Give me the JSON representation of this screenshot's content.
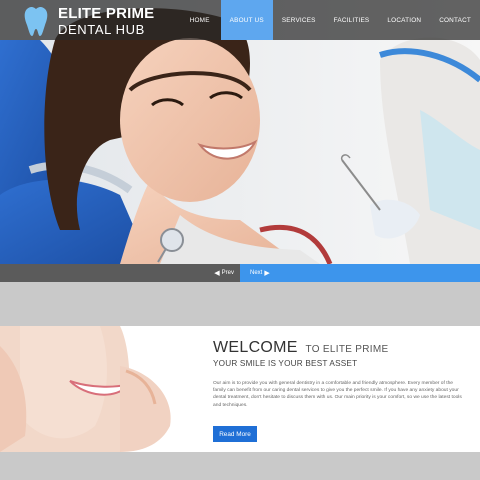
{
  "brand": {
    "line1": "ELITE PRIME",
    "line2": "DENTAL HUB"
  },
  "nav": {
    "items": [
      {
        "label": "HOME",
        "active": false
      },
      {
        "label": "ABOUT US",
        "active": true
      },
      {
        "label": "SERVICES",
        "active": false
      },
      {
        "label": "FACILITIES",
        "active": false
      },
      {
        "label": "LOCATION",
        "active": false
      },
      {
        "label": "CONTACT",
        "active": false
      }
    ]
  },
  "slider": {
    "prev_label": "Prev",
    "next_label": "Next"
  },
  "welcome": {
    "title_big": "WELCOME",
    "title_small": "TO ELITE PRIME",
    "subtitle": "YOUR SMILE IS YOUR BEST ASSET",
    "body": "Our aim is to provide you with general dentistry in a comfortable and friendly atmosphere. Every member of the family can benefit from our caring dental services to give you the perfect smile. If you have any anxiety about your dental treatment, don't hesitate to discuss them with us. Our main priority is your comfort, so we use the latest tools and techniques.",
    "button_label": "Read More"
  },
  "colors": {
    "accent": "#5ea7ef",
    "next_bar": "#3d95ec",
    "button": "#1f6fd6",
    "header_overlay": "#282828"
  }
}
